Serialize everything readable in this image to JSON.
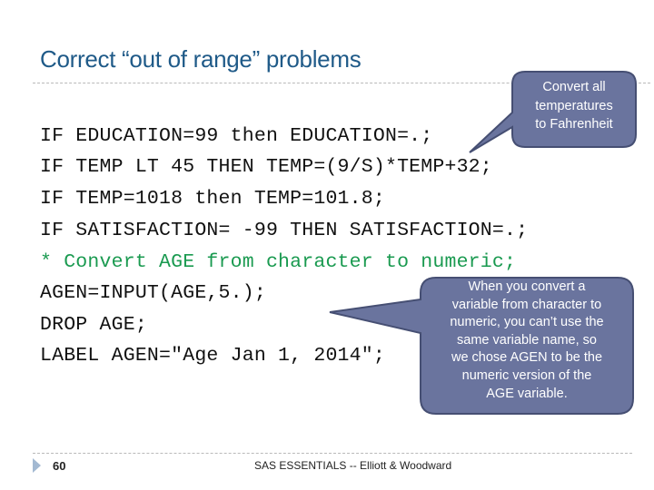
{
  "slide": {
    "title": "Correct “out of range” problems",
    "code_lines": [
      "IF EDUCATION=99 then EDUCATION=.;",
      "IF TEMP LT 45 THEN TEMP=(9/S)*TEMP+32;",
      "IF TEMP=1018 then TEMP=101.8;",
      "IF SATISFACTION= -99 THEN SATISFACTION=.;",
      "* Convert AGE from character to numeric;",
      "AGEN=INPUT(AGE,5.);",
      "DROP AGE;",
      "LABEL AGEN=\"Age Jan 1, 2014\";"
    ],
    "callouts": {
      "temperature": "Convert all\ntemperatures\nto Fahrenheit",
      "agen": "When you convert a\nvariable from character to\nnumeric, you can’t use the\nsame variable name, so\nwe chose AGEN to be the\nnumeric version of the\nAGE variable."
    },
    "footer": {
      "page_number": "60",
      "text": "SAS ESSENTIALS -- Elliott & Woodward"
    }
  },
  "colors": {
    "title": "#1f5a88",
    "comment": "#1a9a50",
    "callout_fill": "#6a749e",
    "callout_border": "#464f73"
  }
}
